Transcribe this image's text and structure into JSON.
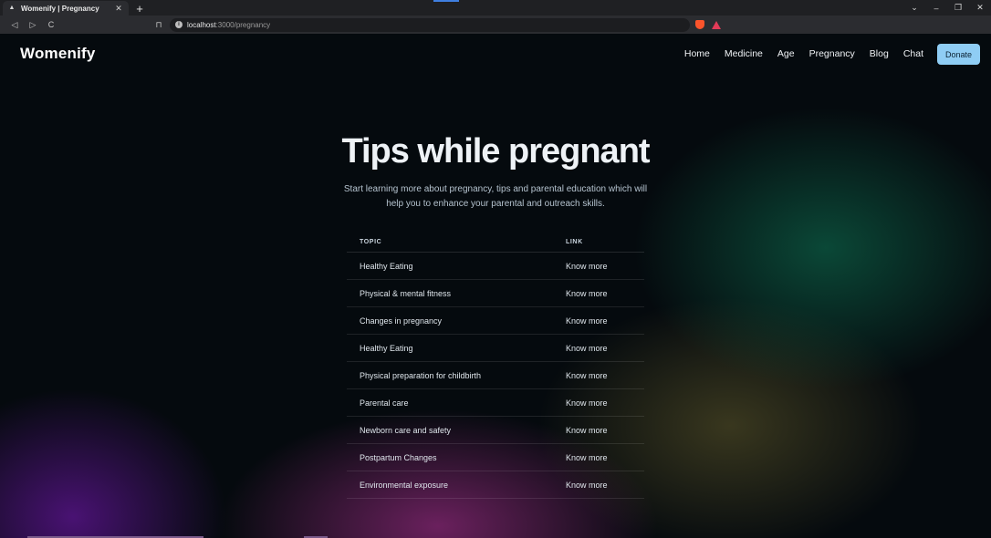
{
  "browser": {
    "tab": {
      "title": "Womenify | Pregnancy",
      "favicon": "▲",
      "close": "✕"
    },
    "new_tab": "+",
    "window": {
      "chevron": "⌄",
      "minimize": "–",
      "restore": "❐",
      "close": "✕"
    },
    "nav": {
      "back": "◁",
      "forward": "▷",
      "reload": "C",
      "bookmark": "⊓"
    },
    "address": {
      "host": "localhost",
      "path": ":3000/pregnancy"
    },
    "extensions_colors": [
      "#3e7ee8",
      "#e0a43b",
      "#b45cf0",
      "#1fb39a",
      "#f0c419",
      "#c8c8c8",
      "#e6e6e6",
      "#5b4fe8",
      "#9aa0a6",
      "#e6c94a",
      "#c94ef0",
      "#e8453c",
      "#d6d6d6",
      "#c8c8c8",
      "#c8c8c8"
    ]
  },
  "navbar": {
    "brand": "Womenify",
    "links": [
      "Home",
      "Medicine",
      "Age",
      "Pregnancy",
      "Blog",
      "Chat"
    ],
    "donate": "Donate"
  },
  "hero": {
    "title": "Tips while pregnant",
    "subtitle": "Start learning more about pregnancy, tips and parental education which will help you to enhance your parental and outreach skills."
  },
  "table": {
    "headers": {
      "topic": "TOPIC",
      "link": "LINK"
    },
    "rows": [
      {
        "topic": "Healthy Eating",
        "link": "Know more"
      },
      {
        "topic": "Physical & mental fitness",
        "link": "Know more"
      },
      {
        "topic": "Changes in pregnancy",
        "link": "Know more"
      },
      {
        "topic": "Healthy Eating",
        "link": "Know more"
      },
      {
        "topic": "Physical preparation for childbirth",
        "link": "Know more"
      },
      {
        "topic": "Parental care",
        "link": "Know more"
      },
      {
        "topic": "Newborn care and safety",
        "link": "Know more"
      },
      {
        "topic": "Postpartum Changes",
        "link": "Know more"
      },
      {
        "topic": "Environmental exposure",
        "link": "Know more"
      }
    ]
  }
}
